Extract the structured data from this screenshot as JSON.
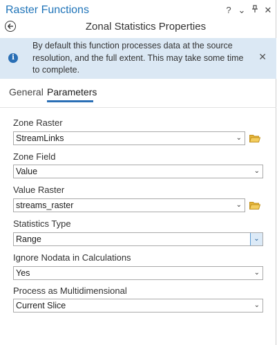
{
  "titlebar": {
    "title": "Raster Functions",
    "controls": [
      "?",
      "⌄",
      " ·",
      "×"
    ]
  },
  "header": {
    "back_icon": "back-arrow-icon",
    "page_title": "Zonal Statistics Properties"
  },
  "banner": {
    "text": "By default this function processes data at the source resolution, and the full extent. This may take some time to complete.",
    "icon": "info-icon",
    "close": "×"
  },
  "tabs": [
    {
      "label": "General",
      "active": false
    },
    {
      "label": "Parameters",
      "active": true
    }
  ],
  "fields": {
    "zone_raster": {
      "label": "Zone Raster",
      "value": "StreamLinks"
    },
    "zone_field": {
      "label": "Zone Field",
      "value": "Value"
    },
    "value_raster": {
      "label": "Value Raster",
      "value": "streams_raster"
    },
    "statistics_type": {
      "label": "Statistics Type",
      "value": "Range"
    },
    "ignore_nodata": {
      "label": "Ignore Nodata in Calculations",
      "value": "Yes"
    },
    "multidimensional": {
      "label": "Process as Multidimensional",
      "value": "Current Slice"
    }
  },
  "colors": {
    "accent": "#1e73b8",
    "banner_bg": "#dbe8f4",
    "folder": "#e8b73a"
  }
}
